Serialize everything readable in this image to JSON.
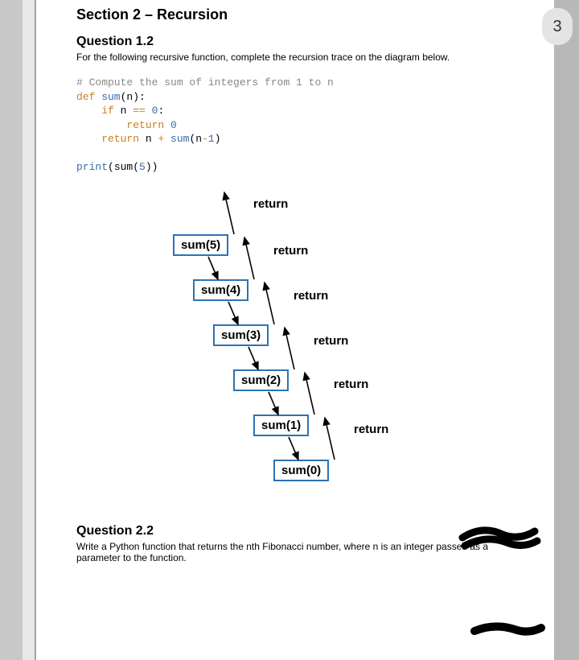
{
  "page_number": "3",
  "section_title": "Section 2 – Recursion",
  "q12": {
    "title": "Question 1.2",
    "body": "For the following recursive function, complete the recursion trace on the diagram below."
  },
  "code": {
    "comment": "# Compute the sum of integers from 1 to n",
    "l1a": "def",
    "l1b": " sum",
    "l1c": "(n):",
    "l2a": "    if",
    "l2b": " n ",
    "l2c": "==",
    "l2d": " 0",
    "l2e": ":",
    "l3a": "        return",
    "l3b": " 0",
    "l4a": "    return",
    "l4b": " n ",
    "l4c": "+",
    "l4d": " sum",
    "l4e": "(n",
    "l4f": "-",
    "l4g": "1",
    "l4h": ")",
    "l5a": "print",
    "l5b": "(sum(",
    "l5c": "5",
    "l5d": "))"
  },
  "diagram": {
    "boxes": [
      "sum(5)",
      "sum(4)",
      "sum(3)",
      "sum(2)",
      "sum(1)",
      "sum(0)"
    ],
    "return_label": "return"
  },
  "q22": {
    "title": "Question 2.2",
    "body": "Write a Python function that returns the nth Fibonacci number, where n is an integer passed as a parameter to the function."
  }
}
